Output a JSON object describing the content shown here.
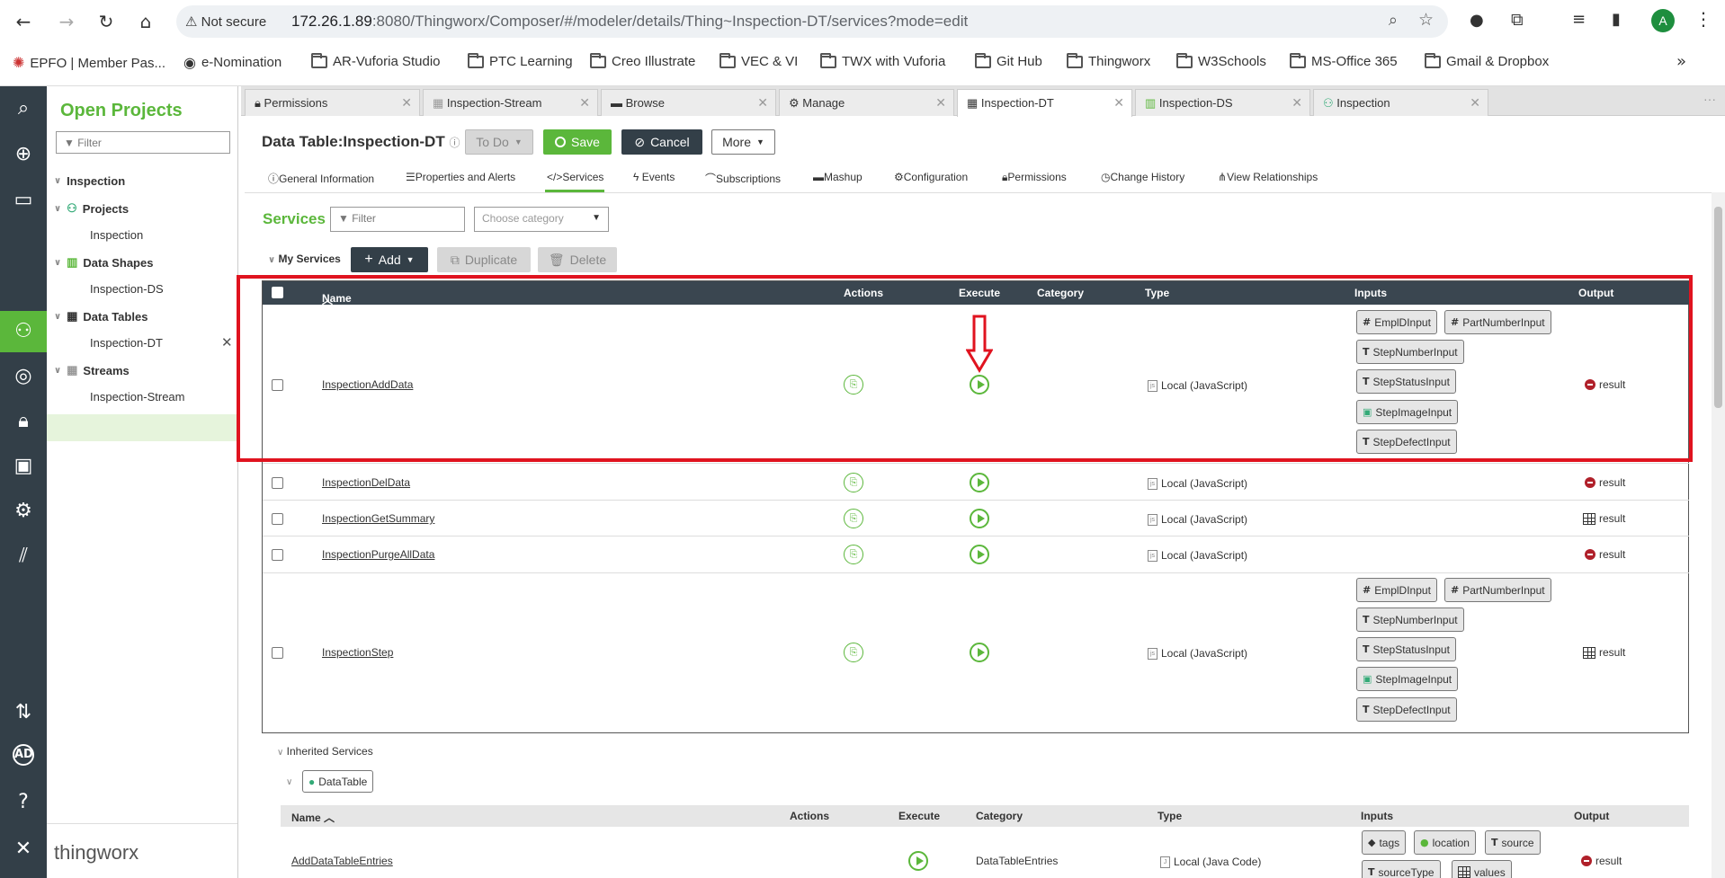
{
  "browser": {
    "not_secure": "Not secure",
    "url_host": "172.26.1.89",
    "url_rest": ":8080/Thingworx/Composer/#/modeler/details/Thing~Inspection-DT/services?mode=edit",
    "avatar_letter": "A",
    "bookmarks": [
      "EPFO | Member Pas...",
      "e-Nomination",
      "AR-Vuforia Studio",
      "PTC Learning",
      "Creo Illustrate",
      "VEC & VI",
      "TWX with Vuforia",
      "Git Hub",
      "Thingworx",
      "W3Schools",
      "MS-Office 365",
      "Gmail & Dropbox"
    ]
  },
  "projects_panel": {
    "title": "Open Projects",
    "filter_placeholder": "Filter",
    "root": "Inspection",
    "groups": [
      {
        "label": "Projects",
        "child": "Inspection"
      },
      {
        "label": "Data Shapes",
        "child": "Inspection-DS"
      },
      {
        "label": "Data Tables",
        "child": "Inspection-DT"
      },
      {
        "label": "Streams",
        "child": "Inspection-Stream"
      }
    ],
    "brand": "thingworx"
  },
  "tabs": [
    "Permissions",
    "Inspection-Stream",
    "Browse",
    "Manage",
    "Inspection-DT",
    "Inspection-DS",
    "Inspection"
  ],
  "header": {
    "title": "Data Table:Inspection-DT",
    "todo": "To Do",
    "save": "Save",
    "cancel": "Cancel",
    "more": "More"
  },
  "subtabs": [
    "General Information",
    "Properties and Alerts",
    "Services",
    "Events",
    "Subscriptions",
    "Mashup",
    "Configuration",
    "Permissions",
    "Change History",
    "View Relationships"
  ],
  "services": {
    "title": "Services",
    "filter_placeholder": "Filter",
    "category_placeholder": "Choose category",
    "my_services": "My Services",
    "add": "Add",
    "duplicate": "Duplicate",
    "delete": "Delete",
    "columns": [
      "Name",
      "Actions",
      "Execute",
      "Category",
      "Type",
      "Inputs",
      "Output"
    ],
    "rows": [
      {
        "name": "InspectionAddData",
        "type": "Local (JavaScript)",
        "output": "result"
      },
      {
        "name": "InspectionDelData",
        "type": "Local (JavaScript)",
        "output": "result"
      },
      {
        "name": "InspectionGetSummary",
        "type": "Local (JavaScript)",
        "output": "result"
      },
      {
        "name": "InspectionPurgeAllData",
        "type": "Local (JavaScript)",
        "output": "result"
      },
      {
        "name": "InspectionStep",
        "type": "Local (JavaScript)",
        "output": "result"
      }
    ],
    "inputs": [
      "EmplDInput",
      "PartNumberInput",
      "StepNumberInput",
      "StepStatusInput",
      "StepImageInput",
      "StepDefectInput"
    ],
    "inherited": "Inherited Services",
    "datatable_chip": "DataTable",
    "inherited_columns": [
      "Name",
      "Actions",
      "Execute",
      "Category",
      "Type",
      "Inputs",
      "Output"
    ],
    "inherited_row": {
      "name": "AddDataTableEntries",
      "category": "DataTableEntries",
      "type": "Local (Java Code)",
      "inputs": [
        "tags",
        "location",
        "source",
        "sourceType",
        "values"
      ],
      "output": "result"
    }
  }
}
